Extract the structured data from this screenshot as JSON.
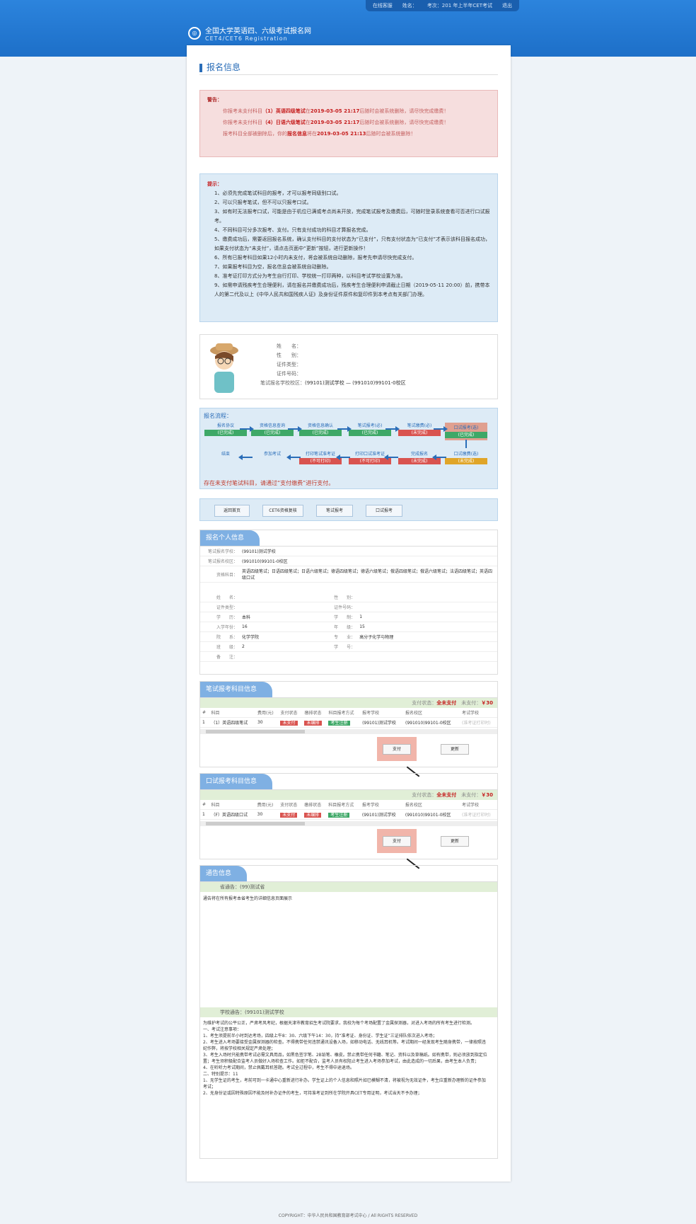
{
  "header": {
    "strip": [
      "在线客服",
      "姓名：",
      "考次：201 年上半年CET考试",
      "退出"
    ],
    "title": "全国大学英语四、六级考试报名网",
    "subtitle": "CET4/CET6 Registration"
  },
  "page_title": "报名信息",
  "warning": {
    "label": "警告：",
    "lines": [
      {
        "pre": "你报考未支付科目",
        "item": "（1）英语四级笔试",
        "mid": "在",
        "time": "2019-03-05 21:17",
        "post": "后随时会被系统删除，请尽快完成缴费！"
      },
      {
        "pre": "你报考未支付科目",
        "item": "（4）日语六级笔试",
        "mid": "在",
        "time": "2019-03-05 21:17",
        "post": "后随时会被系统删除，请尽快完成缴费！"
      },
      {
        "pre": "报考科目全部被删除后，你的",
        "item": "报名信息",
        "mid": "将在",
        "time": "2019-03-05 21:13",
        "post": "后随时会被系统删除！"
      }
    ]
  },
  "tips": {
    "label": "提示：",
    "items": [
      "1、必须先完成笔试科目的报考，才可以报考同级别口试。",
      "2、可以只报考笔试，但不可以只报考口试。",
      "3、如有时无法报考口试，可能是由于机位已满或考点尚未开放，完成笔试报考及缴费后，可随时登录系统查看可否进行口试报考。",
      "4、不同科目可分多次报考、支付。只有支付成功的科目才算报名完成。",
      "5、缴费成功后，需要返回报名系统，确认支付科目的支付状态为“已支付”，只有支付状态为“已支付”才表示该科目报名成功，如果支付状态为“未支付”，请点击页面中“更新”按钮，进行更新操作！",
      "6、所有已报考科目如果12小时内未支付，将会被系统自动删除，报考先申请尽快完成支付。",
      "7、如果报考科目为空，报名信息会被系统自动删除。",
      "8、准考证打印方式分为考生自行打印、学校统一打印两种，以科目考试学校设置为准。",
      "9、如需申请残疾考生合理便利，请在报名并缴费成功后，残疾考生合理便利申请截止日期（2019-05-11 20:00）前，携带本人的第二代及以上《中华人民共和国残疾人证》及身份证件原件和复印件到本考点有关部门办理。"
    ]
  },
  "person": {
    "fields": [
      [
        "姓　　名：",
        ""
      ],
      [
        "性　　别：",
        ""
      ],
      [
        "证件类型：",
        ""
      ],
      [
        "证件号码：",
        ""
      ],
      [
        "笔试报名学校校区：",
        "(99101)测试学校 — (991010)99101-0校区"
      ]
    ]
  },
  "flow": {
    "label": "报名流程：",
    "nodes": [
      {
        "name": "报名协议",
        "state": "(已完成)",
        "c": "g"
      },
      {
        "name": "资格信息查询",
        "state": "(已完成)",
        "c": "g"
      },
      {
        "name": "资格信息确认",
        "state": "(已完成)",
        "c": "g"
      },
      {
        "name": "笔试报考(必)",
        "state": "(已完成)",
        "c": "g"
      },
      {
        "name": "笔试缴费(必)",
        "state": "(未完成)",
        "c": "r"
      },
      {
        "name": "口试报考(选)",
        "state": "(已完成)",
        "c": "g"
      },
      {
        "name": "口试缴费(选)",
        "state": "(未完成)",
        "c": "y"
      },
      {
        "name": "完成报名",
        "state": "(未完成)",
        "c": "r"
      },
      {
        "name": "打印口试准考证",
        "state": "(不可打印)",
        "c": "r"
      },
      {
        "name": "打印笔试准考证",
        "state": "(不可打印)",
        "c": "r"
      },
      {
        "name": "参加考试",
        "state": "",
        "c": ""
      },
      {
        "name": "结束",
        "state": "",
        "c": ""
      }
    ],
    "note": "存在未支付笔试科目，请通过“支付缴费”进行支付。"
  },
  "buttons": [
    "返回首页",
    "CET6资格复核",
    "笔试报考",
    "口试报考"
  ],
  "personal": {
    "title": "报名个人信息",
    "school": [
      "笔试报名学校：",
      "(99101)测试学校"
    ],
    "campus": [
      "笔试报名校区：",
      "(991010)99101-0校区"
    ],
    "qual": [
      "资格科目：",
      "英语四级笔试；日语四级笔试；日语六级笔试；德语四级笔试；德语六级笔试；俄语四级笔试；俄语六级笔试；法语四级笔试；英语四级口试"
    ],
    "grid": [
      [
        "姓　　名：",
        "",
        "性　　别：",
        ""
      ],
      [
        "证件类型：",
        "",
        "证件号码：",
        ""
      ],
      [
        "学　　历：",
        "本科",
        "学　　制：",
        "1"
      ],
      [
        "入学年份：",
        "16",
        "年　　级：",
        "15"
      ],
      [
        "院　　系：",
        "化学学院",
        "专　　业：",
        "高分子化学与物理"
      ],
      [
        "班　　级：",
        "2",
        "学　　号：",
        ""
      ],
      [
        "备　　注：",
        "",
        "",
        ""
      ]
    ]
  },
  "written": {
    "title": "笔试报考科目信息",
    "status_label": "支付状态：",
    "status": "全未支付",
    "unpaid_label": "未支付：",
    "amount": "￥30",
    "headers": [
      "#",
      "科目",
      "费用(元)",
      "支付状态",
      "缴排状态",
      "科目报考方式",
      "报考学校",
      "报名校区",
      "考试学校"
    ],
    "row": [
      "1",
      "（1）英语四级笔试",
      "30",
      "未支付",
      "未编排",
      "考生注册",
      "(99101)测试学校",
      "(991010)99101-0校区",
      "(准考证打印时)"
    ],
    "pay": "支付",
    "update": "更新"
  },
  "oral": {
    "title": "口试报考科目信息",
    "status_label": "支付状态：",
    "status": "全未支付",
    "unpaid_label": "未支付：",
    "amount": "￥30",
    "headers": [
      "#",
      "科目",
      "费用(元)",
      "支付状态",
      "缴排状态",
      "科目报考方式",
      "报考学校",
      "报名校区",
      "考试学校"
    ],
    "row": [
      "1",
      "（F）英语四级口试",
      "30",
      "未支付",
      "未编排",
      "考生注册",
      "(99101)测试学校",
      "(991010)99101-0校区",
      "(准考证打印时)"
    ],
    "pay": "支付",
    "update": "更新"
  },
  "notice": {
    "title": "通告信息",
    "prov_label": "省通告：",
    "prov": "(99)测试省",
    "prov_text": "通告将在所有报考本省考生的详细信息页面展示",
    "school_label": "学校通告：",
    "school": "(99101)测试学校",
    "school_text": "为维护考试的公平公正，严肃考风考纪，根据天津市教育招生考试院要求，我校为每个考场配置了金属探测器，对进入考场的所有考生进行检测。\n一、考试注意事项：\n1、考生须提前半小时到达考场，四级上午8：30、六级下午14：30，持“准考证、身份证、学生证”三证排队依次进入考场；\n2、考生进入考场要接受金属探测器的检查。不得携带任何违禁通讯设备入场，如移动电话、无线耳机等。考试期间一经发现考生随身携带，一律按照违纪作弊，将按学校相关规定严肃处理；\n3、考生入场时只能携带考试必需文具用品，如黑色签字笔、2B铅笔、橡皮。禁止携带任何书籍、笔记、资料以及草稿纸。如有携带，则必须放到指定位置；考生须积极配合监考人员做好入场检查工作。如拒不配合，监考人员有权阻止考生进入考场参加考试，由此造成的一切后果，由考生本人负责；\n4、在听听力考试期间，禁止佩戴耳机答题。考试全过程中，考生不得中途退场。\n二、特别提示：11\n1、无学生证的考生，考前可到一卡通中心重新进行补办。学生证上的个人信息和照片如已模糊不清，将被视为无效证件，考生应重新办理新的证件参加考试；\n2、无身份证或因特殊原因不能及时补办证件的考生，可持准考证到所在学院开具CET专用证明，考试当天不予办理；"
  },
  "footer": "COPYRIGHT：中华人民共和国教育部考试中心 / All RIGHTS RESERVED"
}
